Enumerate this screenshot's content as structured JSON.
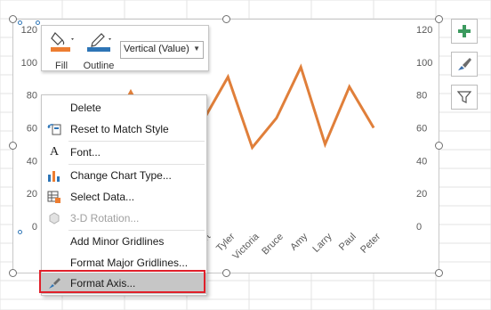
{
  "mini_toolbar": {
    "fill_label": "Fill",
    "outline_label": "Outline",
    "axis_selector_value": "Vertical (Value)"
  },
  "context_menu": {
    "items": [
      {
        "label": "Delete",
        "accel": "D",
        "icon": "none",
        "disabled": false
      },
      {
        "label": "Reset to Match Style",
        "accel": "a",
        "icon": "reset-style-icon",
        "disabled": false
      },
      {
        "label": "Font...",
        "accel": "F",
        "icon": "font-icon",
        "disabled": false
      },
      {
        "label": "Change Chart Type...",
        "accel": "Y",
        "icon": "chart-type-icon",
        "disabled": false
      },
      {
        "label": "Select Data...",
        "accel": "E",
        "icon": "select-data-icon",
        "disabled": false
      },
      {
        "label": "3-D Rotation...",
        "accel": "R",
        "icon": "rotation-3d-icon",
        "disabled": true
      },
      {
        "label": "Add Minor Gridlines",
        "accel": "i",
        "icon": "none",
        "disabled": false
      },
      {
        "label": "Format Major Gridlines...",
        "accel": "M",
        "icon": "none",
        "disabled": false
      },
      {
        "label": "Format Axis...",
        "accel": "F",
        "icon": "format-axis-icon",
        "disabled": false,
        "highlighted": true
      }
    ]
  },
  "side_buttons": [
    {
      "icon": "chart-elements-plus-icon"
    },
    {
      "icon": "chart-styles-brush-icon"
    },
    {
      "icon": "chart-filters-funnel-icon"
    }
  ],
  "chart_data": {
    "type": "line",
    "title": "",
    "xlabel": "",
    "ylabel": "",
    "categories": [
      "Robert",
      "Tyler",
      "Victoria",
      "Bruce",
      "Amy",
      "Larry",
      "Paul",
      "Peter"
    ],
    "series": [
      {
        "values": [
          65,
          91,
          48,
          66,
          97,
          50,
          85,
          60
        ]
      }
    ],
    "ylim": [
      0,
      120
    ],
    "y_ticks_left": [
      "120",
      "100",
      "80",
      "60",
      "40",
      "20",
      "0"
    ],
    "y_ticks_right": [
      "120",
      "100",
      "80",
      "60",
      "40",
      "20",
      "0"
    ],
    "gridlines": false,
    "line_color": "#e07f3a"
  },
  "colors": {
    "fill_swatch": "#ed7d31",
    "outline_swatch": "#2e75b6",
    "highlight_border": "#e0202a",
    "plus_icon": "#3c9a5f"
  }
}
